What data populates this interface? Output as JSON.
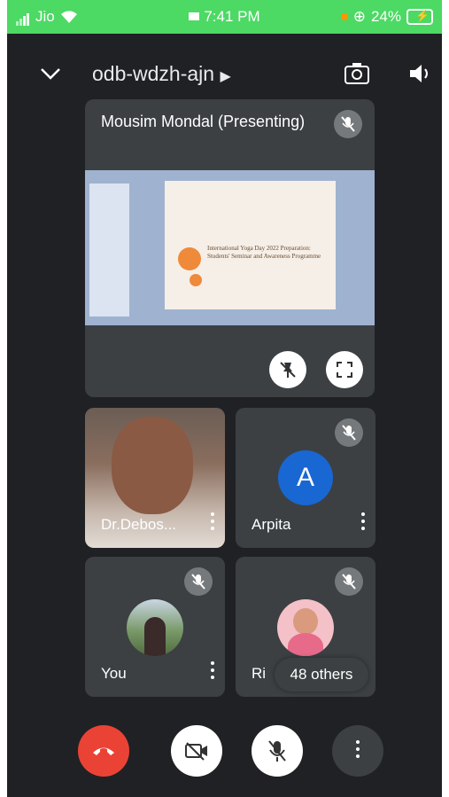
{
  "status": {
    "carrier": "Jio",
    "time": "7:41 PM",
    "battery": "24%"
  },
  "header": {
    "meeting_code": "odb-wdzh-ajn"
  },
  "presentation": {
    "presenter_label": "Mousim Mondal (Presenting)",
    "slide_title": "International Yoga Day 2022 Preparation: Students' Seminar and Awareness Programme"
  },
  "participants": [
    {
      "name": "Dr.Debos..."
    },
    {
      "name": "Arpita",
      "initial": "A"
    },
    {
      "name": "You"
    },
    {
      "name": "Ri"
    }
  ],
  "others": {
    "label": "48 others"
  },
  "colors": {
    "status_green": "#4cd964",
    "background": "#202124",
    "tile": "#3c4043",
    "end_call": "#ea4335",
    "avatar_blue": "#1967d2"
  }
}
